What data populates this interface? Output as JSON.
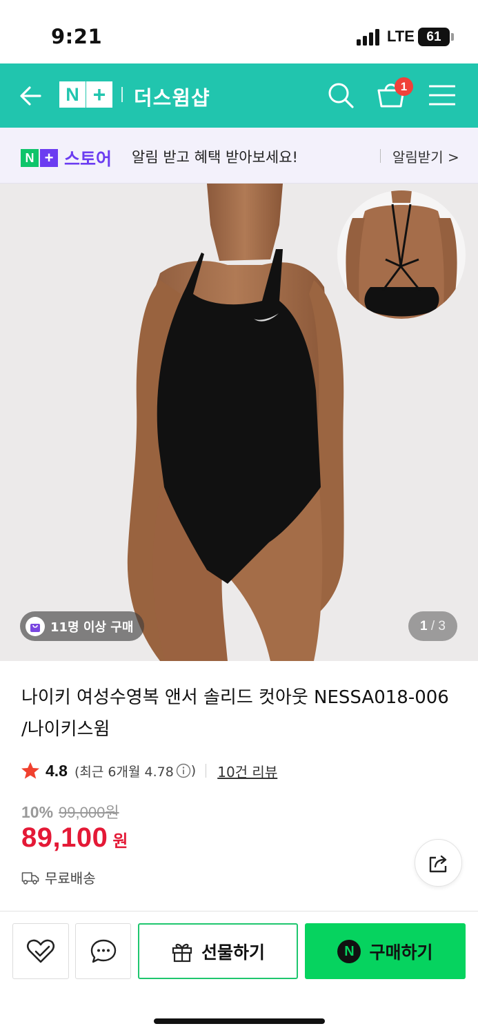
{
  "status_bar": {
    "time": "9:21",
    "network": "LTE",
    "battery": "61"
  },
  "header": {
    "brand_n": "N",
    "brand_plus": "+",
    "shop_name": "더스윔샵",
    "cart_count": "1",
    "brand_color": "#21c5ae"
  },
  "notice": {
    "store_label": "스토어",
    "message": "알림 받고 혜택 받아보세요!",
    "action": "알림받기 >"
  },
  "gallery": {
    "buyer_badge": "11명 이상 구매",
    "current": "1",
    "separator": "/",
    "total": "3"
  },
  "product": {
    "title": "나이키 여성수영복 앤서 솔리드 컷아웃 NESSA018-006 /나이키스윔",
    "rating": "4.8",
    "recent_rating_prefix": "(최근 6개월 4.78",
    "recent_rating_suffix": ")",
    "review_link": "10건 리뷰",
    "discount_rate": "10%",
    "original_price": "99,000원",
    "sale_price": "89,100",
    "currency": "원",
    "shipping": "무료배송",
    "price_color": "#e41936"
  },
  "actions": {
    "gift_label": "선물하기",
    "buy_label": "구매하기",
    "buy_badge": "N",
    "buy_color": "#06d35f"
  }
}
